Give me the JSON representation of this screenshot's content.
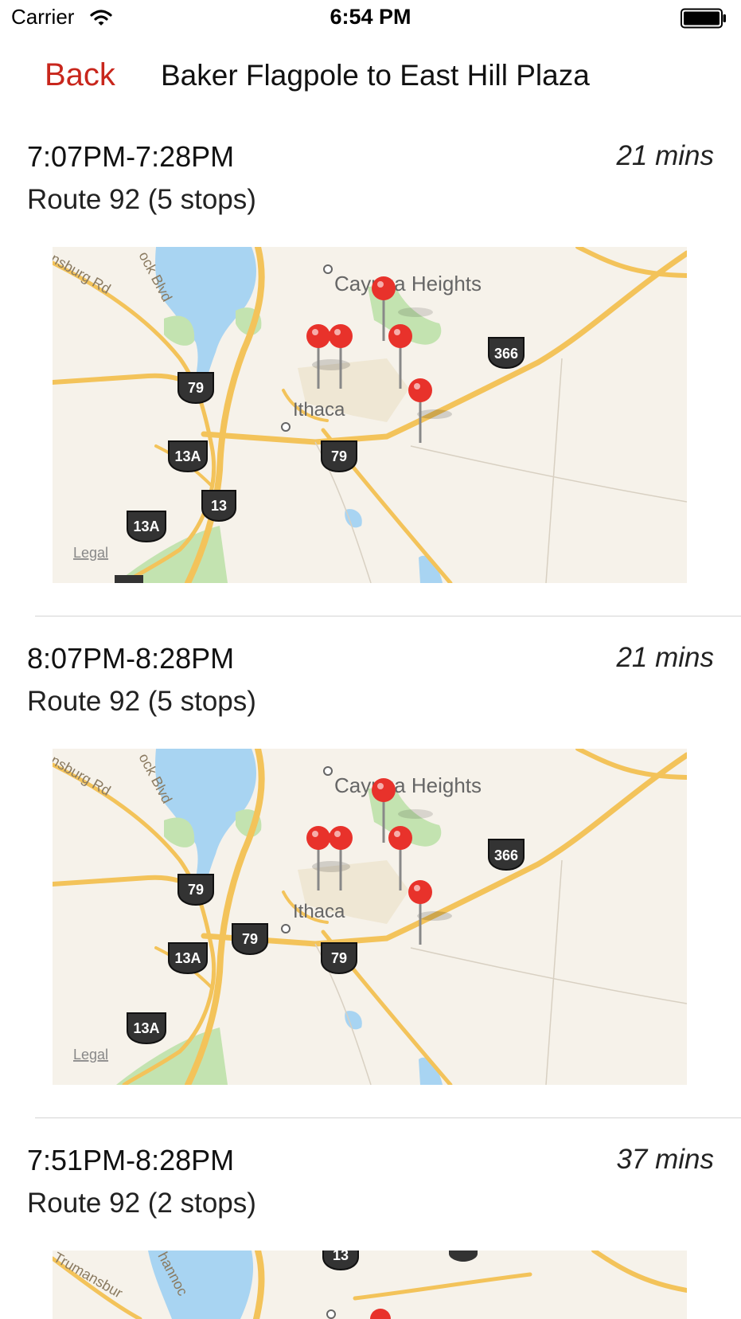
{
  "status_bar": {
    "carrier": "Carrier",
    "time": "6:54 PM"
  },
  "nav": {
    "back_label": "Back",
    "title": "Baker Flagpole to East Hill Plaza"
  },
  "trips": [
    {
      "time": "7:07PM-7:28PM",
      "duration": "21 mins",
      "route": "Route 92 (5 stops)",
      "map": {
        "town": "Ithaca",
        "place": "Cayuga Heights",
        "road_labels": [
          "nsburg Rd",
          "ock Blvd"
        ],
        "shields": [
          "366",
          "79",
          "13A",
          "79",
          "13",
          "13A"
        ],
        "legal": "Legal"
      }
    },
    {
      "time": "8:07PM-8:28PM",
      "duration": "21 mins",
      "route": "Route 92 (5 stops)",
      "map": {
        "town": "Ithaca",
        "place": "Cayuga Heights",
        "road_labels": [
          "nsburg Rd",
          "ock Blvd"
        ],
        "shields": [
          "366",
          "79",
          "13A",
          "79",
          "79",
          "13A"
        ],
        "legal": "Legal"
      }
    },
    {
      "time": "7:51PM-8:28PM",
      "duration": "37 mins",
      "route": "Route 92 (2 stops)",
      "map": {
        "road_labels": [
          "Trumansbur",
          "hannoc"
        ],
        "shields": [
          "13"
        ]
      }
    }
  ],
  "colors": {
    "accent": "#c8261c",
    "pin": "#e8322b",
    "water": "#a8d4f2",
    "park": "#c3e3b0",
    "road": "#f7c45a"
  }
}
